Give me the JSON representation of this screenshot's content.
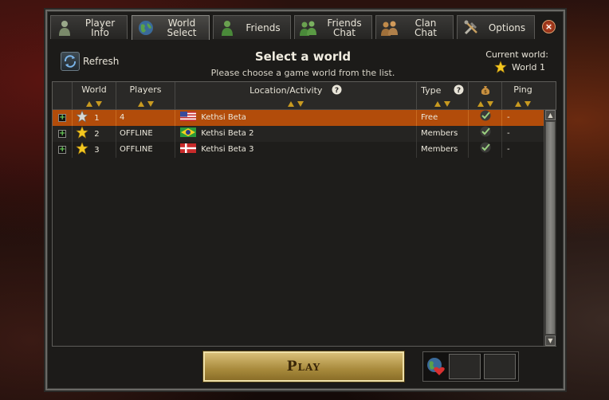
{
  "tabs": [
    {
      "line1": "Player",
      "line2": "Info",
      "icon": "player-icon",
      "active": false
    },
    {
      "line1": "World",
      "line2": "Select",
      "icon": "globe-icon",
      "active": true
    },
    {
      "line1": "Friends",
      "line2": "",
      "icon": "friends-icon",
      "active": false
    },
    {
      "line1": "Friends",
      "line2": "Chat",
      "icon": "friends-chat-icon",
      "active": false
    },
    {
      "line1": "Clan",
      "line2": "Chat",
      "icon": "clan-chat-icon",
      "active": false
    },
    {
      "line1": "Options",
      "line2": "",
      "icon": "tools-icon",
      "active": false
    }
  ],
  "close_label": "×",
  "refresh_label": "Refresh",
  "title": "Select a world",
  "subtitle": "Please choose a game world from the list.",
  "current_world": {
    "label": "Current world:",
    "value": "World 1"
  },
  "columns": {
    "world": "World",
    "players": "Players",
    "location": "Location/Activity",
    "type": "Type",
    "ping": "Ping"
  },
  "rows": [
    {
      "world": "1",
      "players": "4",
      "location": "Kethsi Beta",
      "flag": "us",
      "type": "Free",
      "ping": "-",
      "selected": true,
      "star": "silver"
    },
    {
      "world": "2",
      "players": "OFFLINE",
      "location": "Kethsi Beta 2",
      "flag": "br",
      "type": "Members",
      "ping": "-",
      "selected": false,
      "star": "gold"
    },
    {
      "world": "3",
      "players": "OFFLINE",
      "location": "Kethsi Beta 3",
      "flag": "dk",
      "type": "Members",
      "ping": "-",
      "selected": false,
      "star": "gold"
    }
  ],
  "play_label": "Play",
  "colors": {
    "selected_row": "#b24c0a",
    "play_gold": "#c8aa58",
    "star_gold": "#f4c820"
  }
}
